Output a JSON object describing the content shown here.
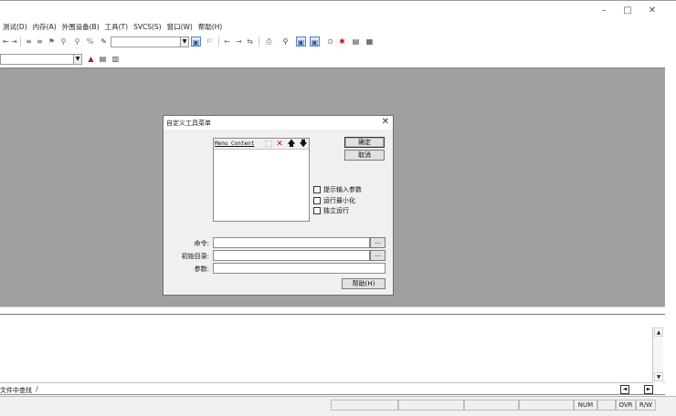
{
  "window": {
    "controls": {
      "minimize": "–",
      "maximize": "□",
      "close": "✕"
    }
  },
  "menubar": {
    "items": [
      "测试(D)",
      "内存(A)",
      "外围设备(B)",
      "工具(T)",
      "SVCS(S)",
      "窗口(W)",
      "帮助(H)"
    ]
  },
  "toolbar": {
    "icons": [
      "indent-icon",
      "outdent-icon",
      "comment-icon",
      "uncomment-icon",
      "bookmark-icon",
      "find-icon",
      "replace-icon",
      "find-in-files-icon",
      "back-icon",
      "forward-icon",
      "print-icon",
      "zoom-icon",
      "toggle-window-icon",
      "watch-icon",
      "breakpoint-icon",
      "register-icon",
      "memory-icon"
    ]
  },
  "dialog": {
    "title": "自定义工具菜单",
    "close": "✕",
    "list_header": "Menu Content",
    "ok_label": "确定",
    "cancel_label": "取消",
    "options": [
      "提示输入参数",
      "运行最小化",
      "独立运行"
    ],
    "fields": [
      {
        "label": "命令:",
        "value": ""
      },
      {
        "label": "初始目录:",
        "value": ""
      },
      {
        "label": "参数:",
        "value": ""
      }
    ],
    "browse_label": "...",
    "help_label": "帮助(H)"
  },
  "output": {
    "tab_label": "文件中查找",
    "scroll_up": "▲",
    "scroll_down": "▼",
    "scroll_left": "◄",
    "scroll_right": "►"
  },
  "statusbar": {
    "num": "NUM",
    "ovr": "OVR",
    "rw": "R/W"
  }
}
